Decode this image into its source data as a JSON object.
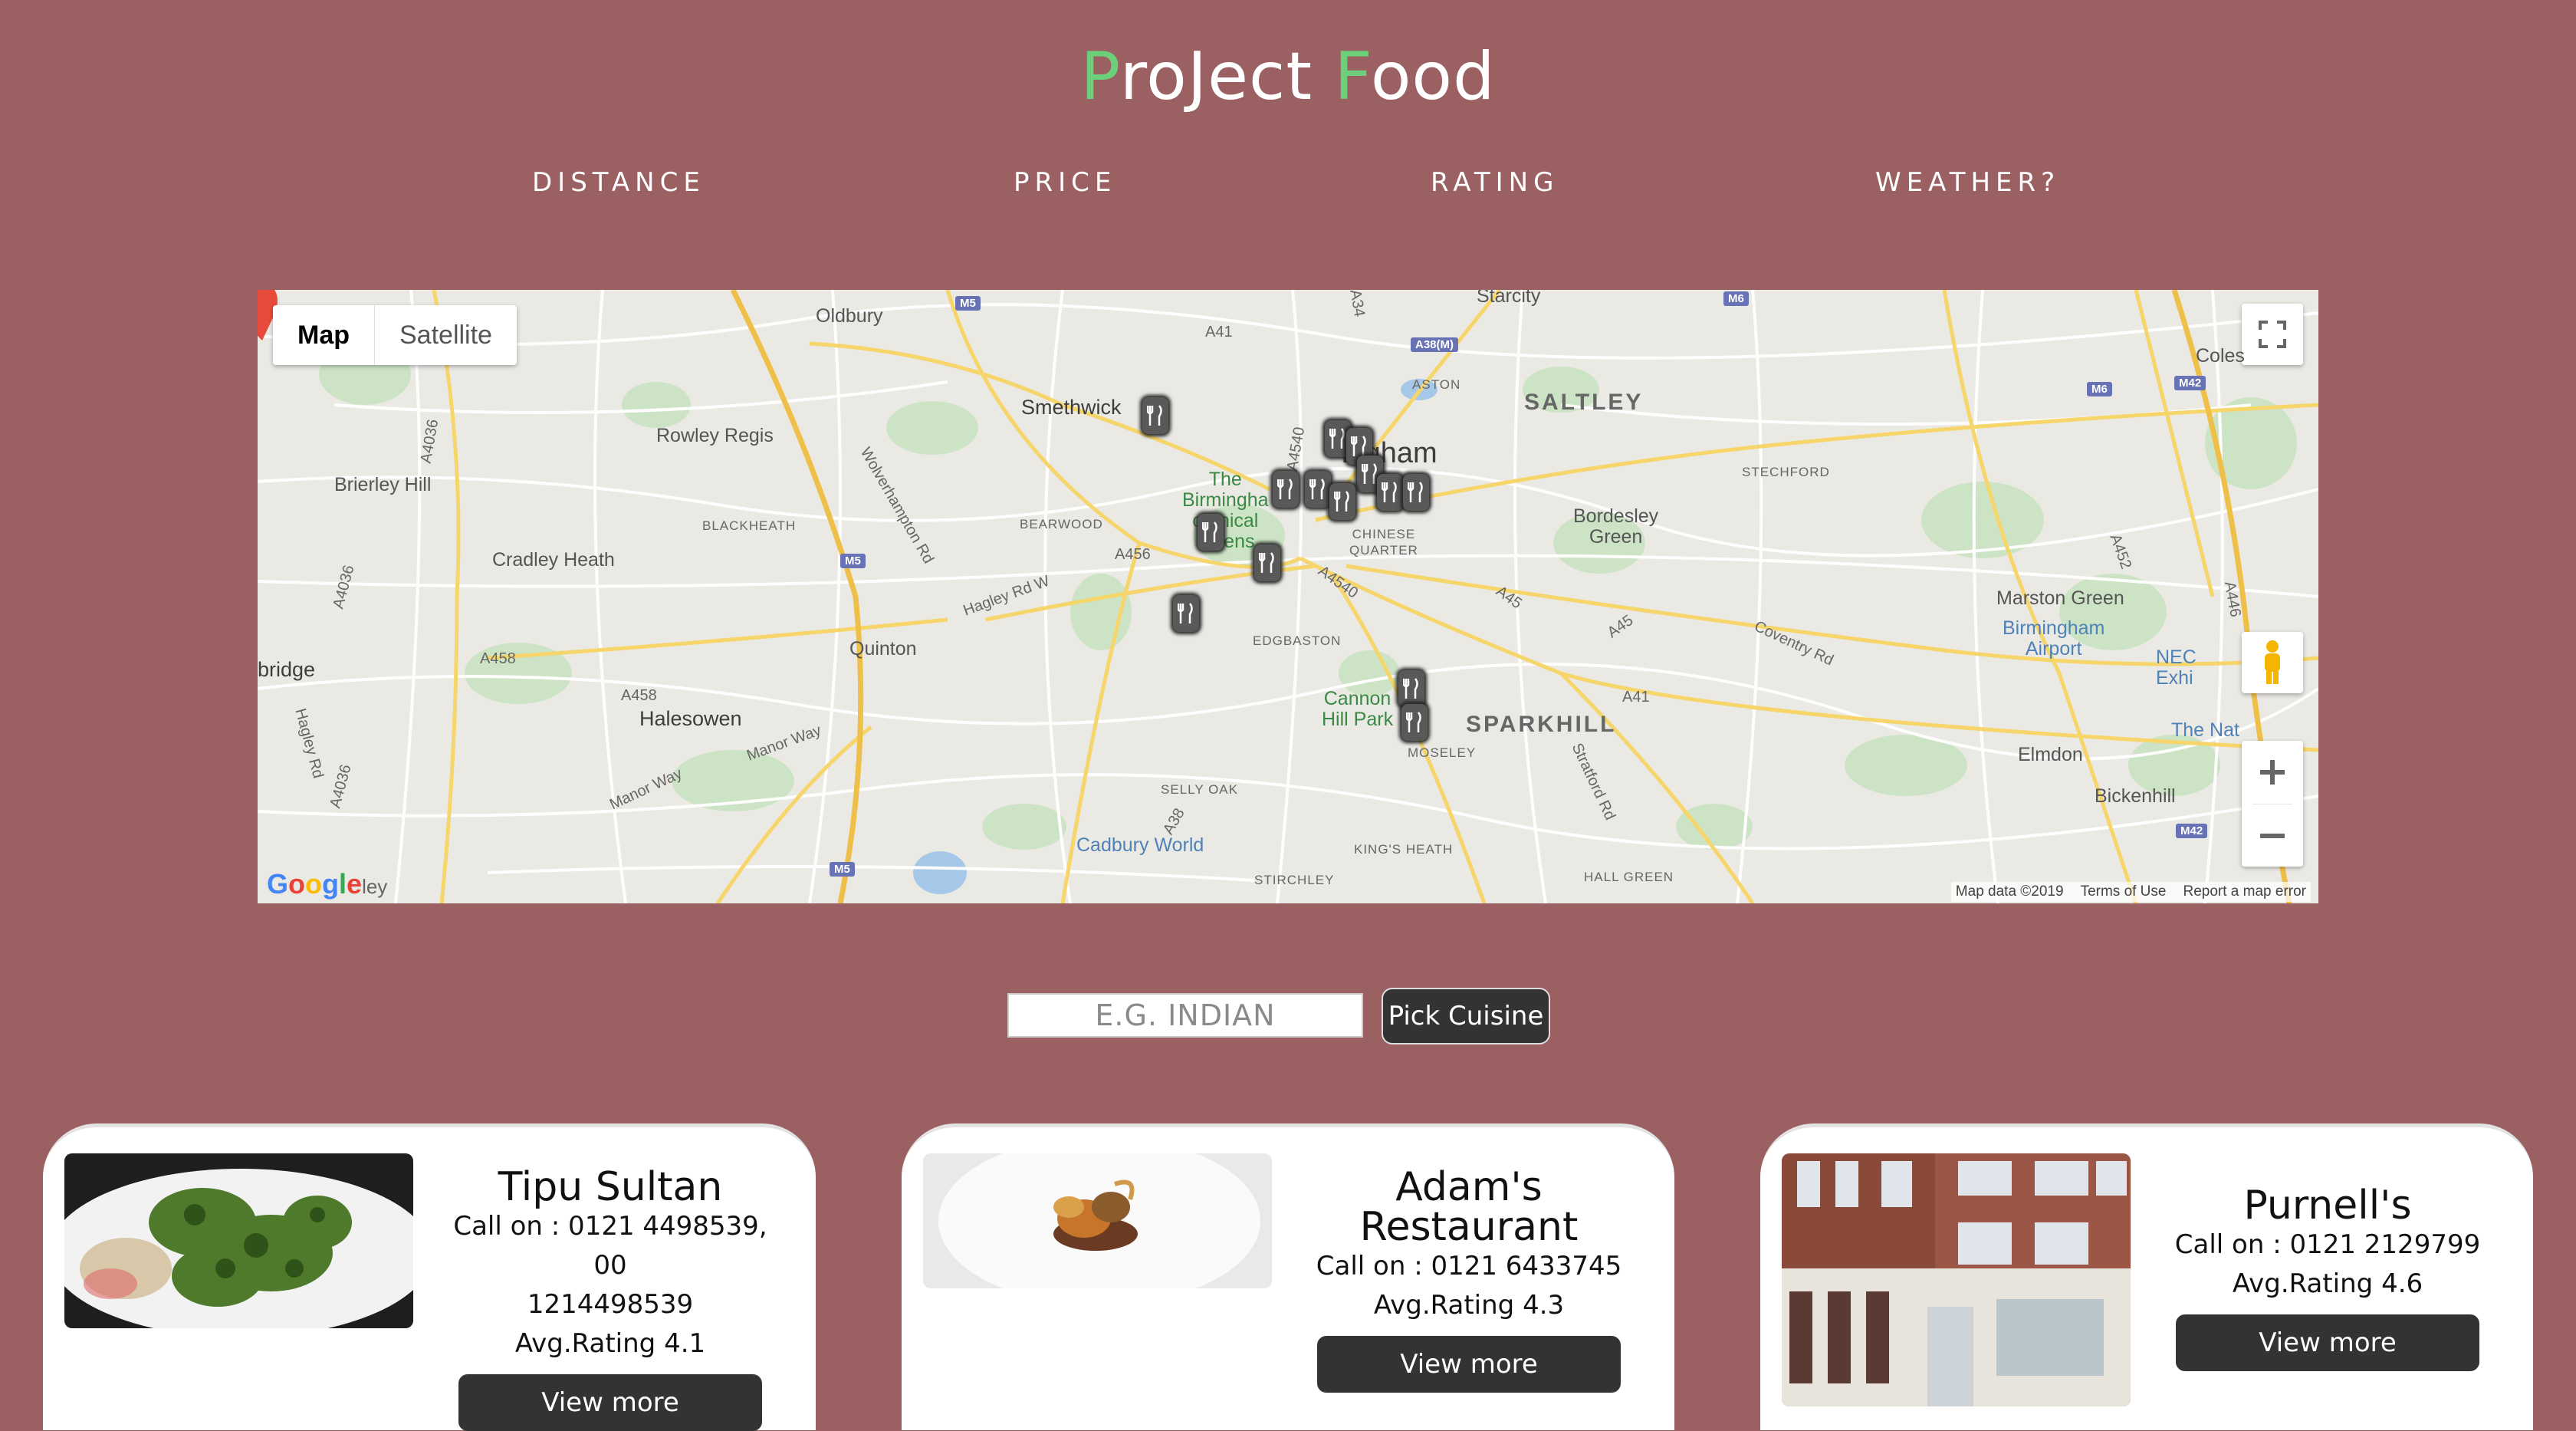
{
  "header": {
    "title_p": "P",
    "title_mid": "roJect ",
    "title_f": "F",
    "title_rest": "ood"
  },
  "nav": [
    {
      "label": "DISTANCE"
    },
    {
      "label": "PRICE"
    },
    {
      "label": "RATING"
    },
    {
      "label": "WEATHER?"
    }
  ],
  "map": {
    "type_map": "Map",
    "type_satellite": "Satellite",
    "attribution": "Map data ©2019",
    "terms": "Terms of Use",
    "report": "Report a map error",
    "google": "Google",
    "google_suffix": "ley",
    "labels": {
      "oldbury": "Oldbury",
      "smethwick": "Smethwick",
      "rowley": "Rowley Regis",
      "brierley": "Brierley Hill",
      "blackheath": "BLACKHEATH",
      "bearwood": "BEARWOOD",
      "cradley": "Cradley Heath",
      "quinton": "Quinton",
      "halesowen": "Halesowen",
      "bridge": "bridge",
      "birmingham": "ingham",
      "saltley": "SALTLEY",
      "aston": "ASTON",
      "stechford": "STECHFORD",
      "bordesley": "Bordesley\nGreen",
      "chinese": "CHINESE\nQUARTER",
      "botanical": "The\nBirmingha\notanical\nardens",
      "edgbaston": "EDGBASTON",
      "cannon": "Cannon\nHill Park",
      "sparkhill": "SPARKHILL",
      "moseley": "MOSELEY",
      "selly": "SELLY OAK",
      "cadbury": "Cadbury World",
      "kings": "KING'S HEATH",
      "stirchley": "STIRCHLEY",
      "hallgreen": "HALL GREEN",
      "marston": "Marston Green",
      "airport": "Birmingham\nAirport",
      "elmdon": "Elmdon",
      "bickenhill": "Bickenhill",
      "coles": "Coles",
      "nec": "NEC\nExhi",
      "thenat": "The Nat",
      "starcity": "Starcity"
    },
    "roads": {
      "m5a": "M5",
      "m5b": "M5",
      "m5c": "M5",
      "m6a": "M6",
      "m6b": "M6",
      "m42a": "M42",
      "m42b": "M42",
      "a38m": "A38(M)",
      "a41a": "A41",
      "a41b": "A41",
      "a456": "A456",
      "a458a": "A458",
      "a458b": "A458",
      "a4540a": "A4540",
      "a4540b": "A4540",
      "a45a": "A45",
      "a45b": "A45",
      "a4036a": "A4036",
      "a4036b": "A4036",
      "a4036c": "A4036",
      "a38": "A38",
      "a452": "A452",
      "a446": "A446",
      "hagley": "Hagley Rd W",
      "wolverhampton": "Wolverhampton Rd",
      "manor1": "Manor Way",
      "manor2": "Manor Way",
      "coventry": "Coventry Rd",
      "stratford": "Stratford Rd",
      "hagleyrd": "Hagley Rd",
      "a34": "A34"
    }
  },
  "search": {
    "placeholder": "E.G. INDIAN",
    "button": "Pick Cuisine"
  },
  "restaurants": [
    {
      "name": "Tipu Sultan",
      "phone": "Call on : 0121 4498539, 00",
      "phone2": "1214498539",
      "rating": "Avg.Rating 4.1",
      "button": "View more"
    },
    {
      "name": "Adam's",
      "name2": "Restaurant",
      "phone": "Call on : 0121 6433745",
      "rating": "Avg.Rating 4.3",
      "button": "View more"
    },
    {
      "name": "Purnell's",
      "phone": "Call on : 0121 2129799",
      "rating": "Avg.Rating 4.6",
      "button": "View more"
    }
  ]
}
